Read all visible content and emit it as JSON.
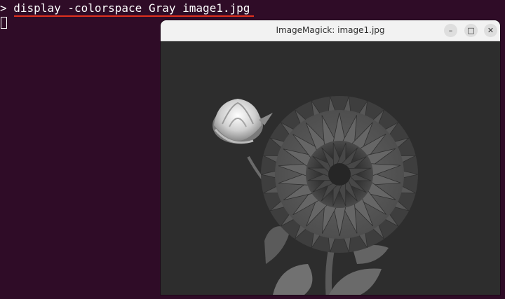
{
  "terminal": {
    "prompt": ">",
    "command": "display -colorspace Gray image1.jpg",
    "underline_color": "#e0301e",
    "background_color": "#2f0c27"
  },
  "window": {
    "title": "ImageMagick: image1.jpg",
    "buttons": {
      "minimize": "–",
      "maximize": "□",
      "close": "✕"
    },
    "image": {
      "subject": "grayscale dahlia flower with bud",
      "background_color": "#2d2d2d"
    }
  }
}
